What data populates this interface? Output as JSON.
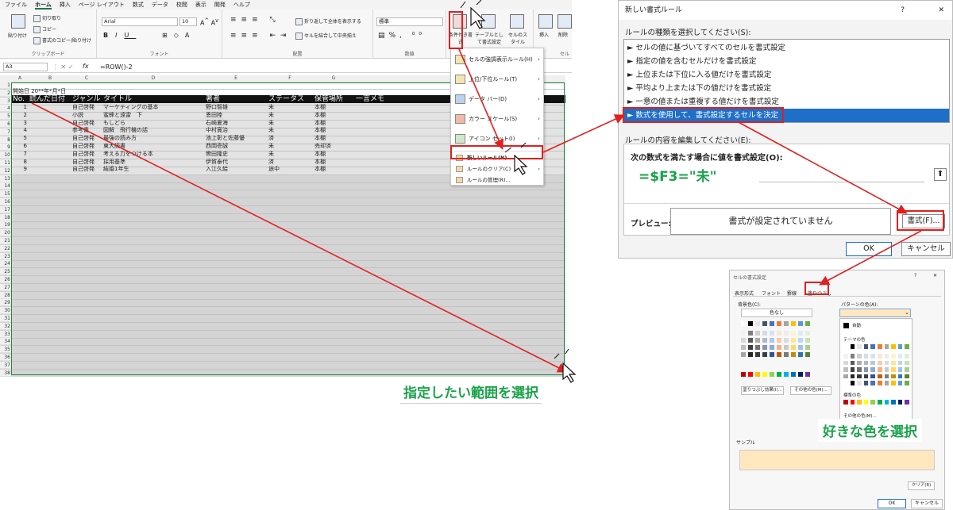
{
  "menubar": [
    "ファイル",
    "ホーム",
    "挿入",
    "ページ レイアウト",
    "数式",
    "データ",
    "校閲",
    "表示",
    "開発",
    "ヘルプ"
  ],
  "ribbon": {
    "paste": "貼り付け",
    "cut": "切り取り",
    "copy": "コピー",
    "format_painter": "書式のコピー/貼り付け",
    "clipboard": "クリップボード",
    "font_name": "Arial",
    "font_size": "10",
    "font_group": "フォント",
    "wrap": "折り返して全体を表示する",
    "merge": "セルを結合して中央揃え",
    "align_group": "配置",
    "num_format": "標準",
    "number_group": "数値",
    "cond_format": "条件付き書式",
    "table_format": "テーブルとして書式設定",
    "cell_style": "セルのスタイル",
    "insert": "挿入",
    "delete": "削除",
    "cells_group": "セル"
  },
  "formula": {
    "namebox": "A3",
    "fx": "fx",
    "value": "=ROW()-2"
  },
  "grid": {
    "columns": [
      "A",
      "B",
      "C",
      "D",
      "E",
      "F",
      "G"
    ],
    "a1": "開始日 20**年*月*日",
    "headers": [
      "No.",
      "読んだ日付",
      "ジャンル",
      "タイトル",
      "著者",
      "ステータス",
      "保管場所",
      "一言メモ"
    ],
    "rows": [
      [
        "1",
        "",
        "自己啓発",
        "マーケティングの基本",
        "野口智雄",
        "未",
        "本棚"
      ],
      [
        "2",
        "",
        "小説",
        "蜜蜂と遠雷　下",
        "恩田陸",
        "未",
        "本棚"
      ],
      [
        "3",
        "",
        "自己啓発",
        "もしどら",
        "石崎夏海",
        "未",
        "本棚"
      ],
      [
        "4",
        "",
        "参考書",
        "図解　飛行機の話",
        "中村寛治",
        "未",
        "本棚"
      ],
      [
        "5",
        "",
        "自己啓発",
        "最強の読み方",
        "池上彰と佐藤優",
        "済",
        "本棚"
      ],
      [
        "6",
        "",
        "自己啓発",
        "東大読書",
        "西岡壱誠",
        "未",
        "売却済"
      ],
      [
        "7",
        "",
        "自己啓発",
        "考える力をつける本",
        "轡田隆史",
        "未",
        "本棚"
      ],
      [
        "8",
        "",
        "自己啓発",
        "採用基準",
        "伊賀泰代",
        "済",
        "本棚"
      ],
      [
        "9",
        "",
        "自己啓発",
        "結婚1年生",
        "入江久絵",
        "途中",
        "本棚"
      ]
    ],
    "row_numbers": [
      "1",
      "2",
      "3",
      "4",
      "5",
      "6",
      "7",
      "8",
      "9",
      "10",
      "11",
      "12",
      "13",
      "14",
      "15",
      "16",
      "17",
      "18",
      "19",
      "20",
      "21",
      "22",
      "23",
      "24",
      "25",
      "26",
      "27",
      "28",
      "29",
      "30",
      "31",
      "32",
      "33",
      "34",
      "35",
      "36",
      "37",
      "38"
    ]
  },
  "cf_menu": {
    "items": [
      "セルの強調表示ルール(H)",
      "上位/下位ルール(T)",
      "データ バー(D)",
      "カラー スケール(S)",
      "アイコン セット(I)"
    ],
    "new_rule": "新しいルール(N)...",
    "clear_rules": "ルールのクリア(C)",
    "manage_rules": "ルールの管理(R)..."
  },
  "new_rule_dialog": {
    "title": "新しい書式ルール",
    "help": "?",
    "close": "✕",
    "type_label": "ルールの種類を選択してください(S):",
    "rule_types": [
      "► セルの値に基づいてすべてのセルを書式設定",
      "► 指定の値を含むセルだけを書式設定",
      "► 上位または下位に入る値だけを書式設定",
      "► 平均より上または下の値だけを書式設定",
      "► 一意の値または重複する値だけを書式設定",
      "► 数式を使用して、書式設定するセルを決定"
    ],
    "edit_label": "ルールの内容を編集してください(E):",
    "formula_label": "次の数式を満たす場合に値を書式設定(O):",
    "formula_value": "=$F3=\"未\"",
    "preview_label": "プレビュー:",
    "preview_text": "書式が設定されていません",
    "format_button": "書式(F)...",
    "ok": "OK",
    "cancel": "キャンセル"
  },
  "format_cells_dialog": {
    "title": "セルの書式設定",
    "help": "?",
    "close": "✕",
    "tabs": [
      "表示形式",
      "フォント",
      "罫線",
      "塗りつぶし"
    ],
    "bg_label": "背景色(C):",
    "no_color": "色なし",
    "pattern_color_label": "パターンの色(A):",
    "auto": "自動",
    "theme_colors": "テーマの色",
    "standard_colors": "標準の色",
    "other_colors_small": "その他の色(M)...",
    "fill_effects": "塗りつぶし効果(I)...",
    "other_colors": "その他の色(M)...",
    "sample_label": "サンプル",
    "clear": "クリア(R)",
    "ok": "OK",
    "cancel": "キャンセル",
    "sample_color": "#ffe7c0"
  },
  "annotations": {
    "select_range": "指定したい範囲を選択",
    "pick_color": "好きな色を選択"
  },
  "colors": {
    "accent_red": "#e02020",
    "note_green": "#1aa34a",
    "excel_green": "#217346",
    "selection_blue": "#1e6fc8"
  }
}
